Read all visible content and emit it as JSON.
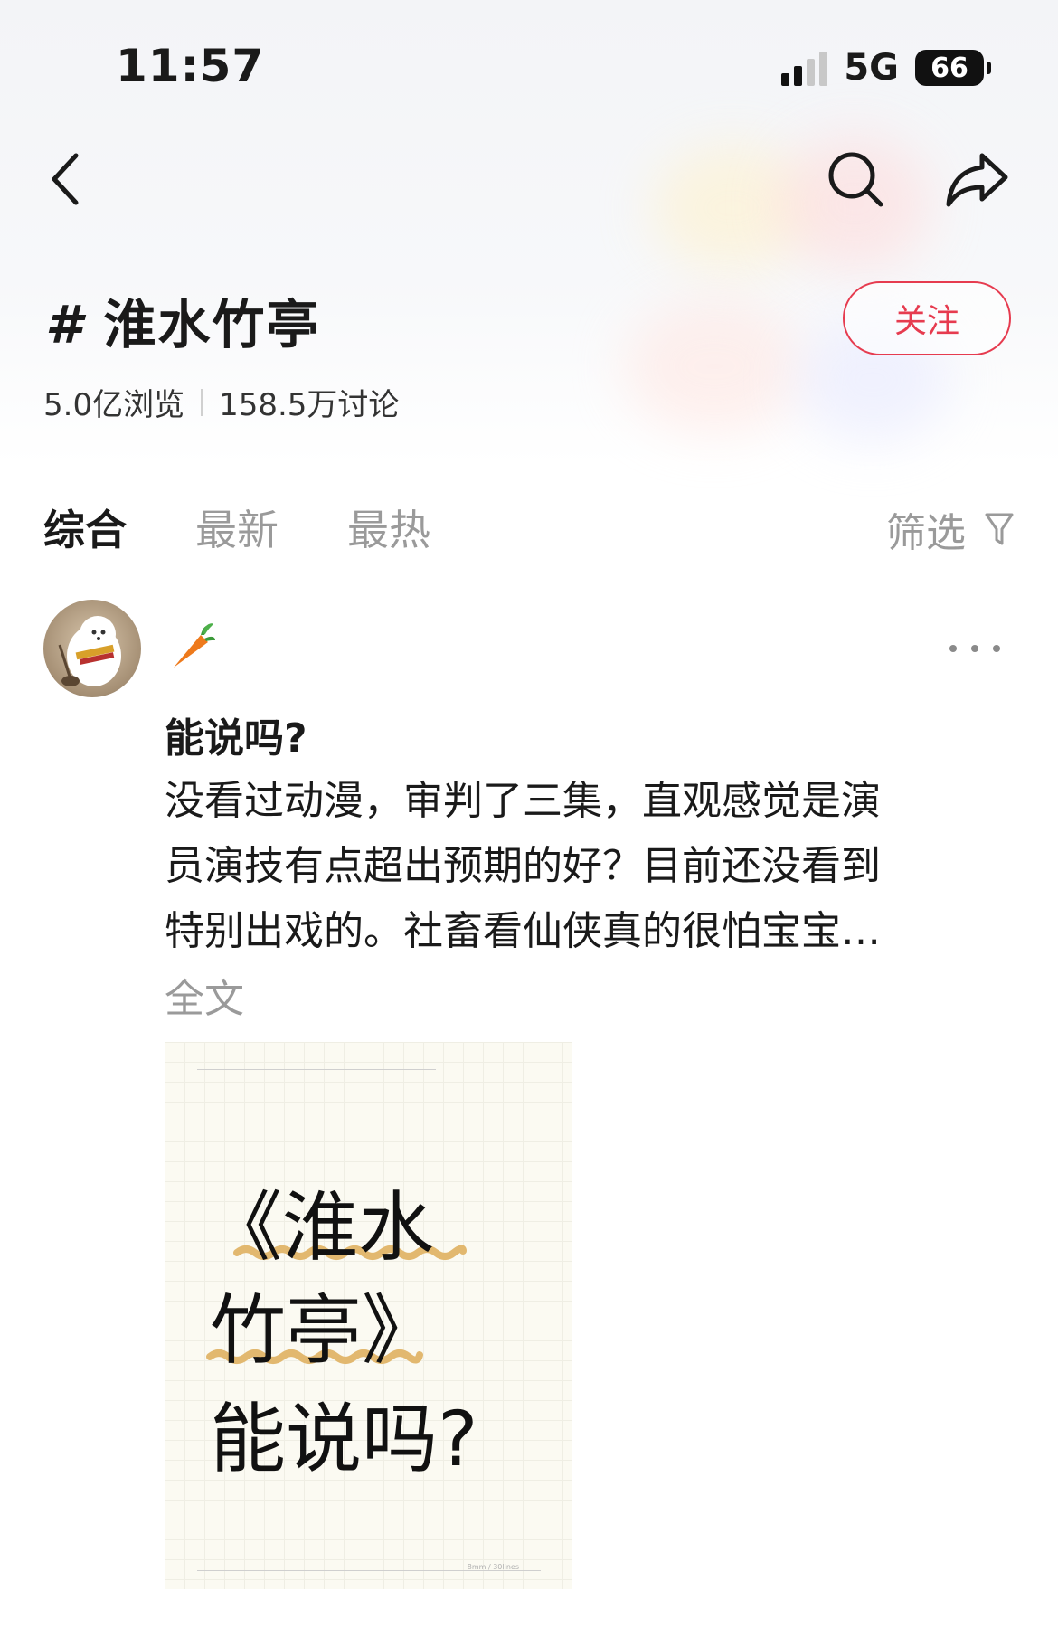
{
  "status_bar": {
    "time": "11:57",
    "network": "5G",
    "battery": "66"
  },
  "nav": {
    "back_icon": "chevron-left-icon",
    "search_icon": "search-icon",
    "share_icon": "share-icon"
  },
  "topic": {
    "hash": "#",
    "title": "淮水竹亭",
    "follow_label": "关注",
    "views": "5.0亿浏览",
    "discussions": "158.5万讨论"
  },
  "tabs": [
    {
      "label": "综合",
      "active": true
    },
    {
      "label": "最新",
      "active": false
    },
    {
      "label": "最热",
      "active": false
    }
  ],
  "filter": {
    "label": "筛选",
    "icon": "filter-icon"
  },
  "post": {
    "author_name": "🥕",
    "title": "能说吗?",
    "body_lines": [
      "没看过动漫，审判了三集，直观感觉是演",
      "员演技有点超出预期的好？目前还没看到",
      "特别出戏的。社畜看仙侠真的很怕宝宝…"
    ],
    "read_more": "全文",
    "image": {
      "line1": "《淮水",
      "line2": "竹亭》",
      "line3": "能说吗?",
      "footer": "8mm / 30lines"
    }
  },
  "colors": {
    "accent": "#e63b4f",
    "muted": "#9a9a9a"
  }
}
